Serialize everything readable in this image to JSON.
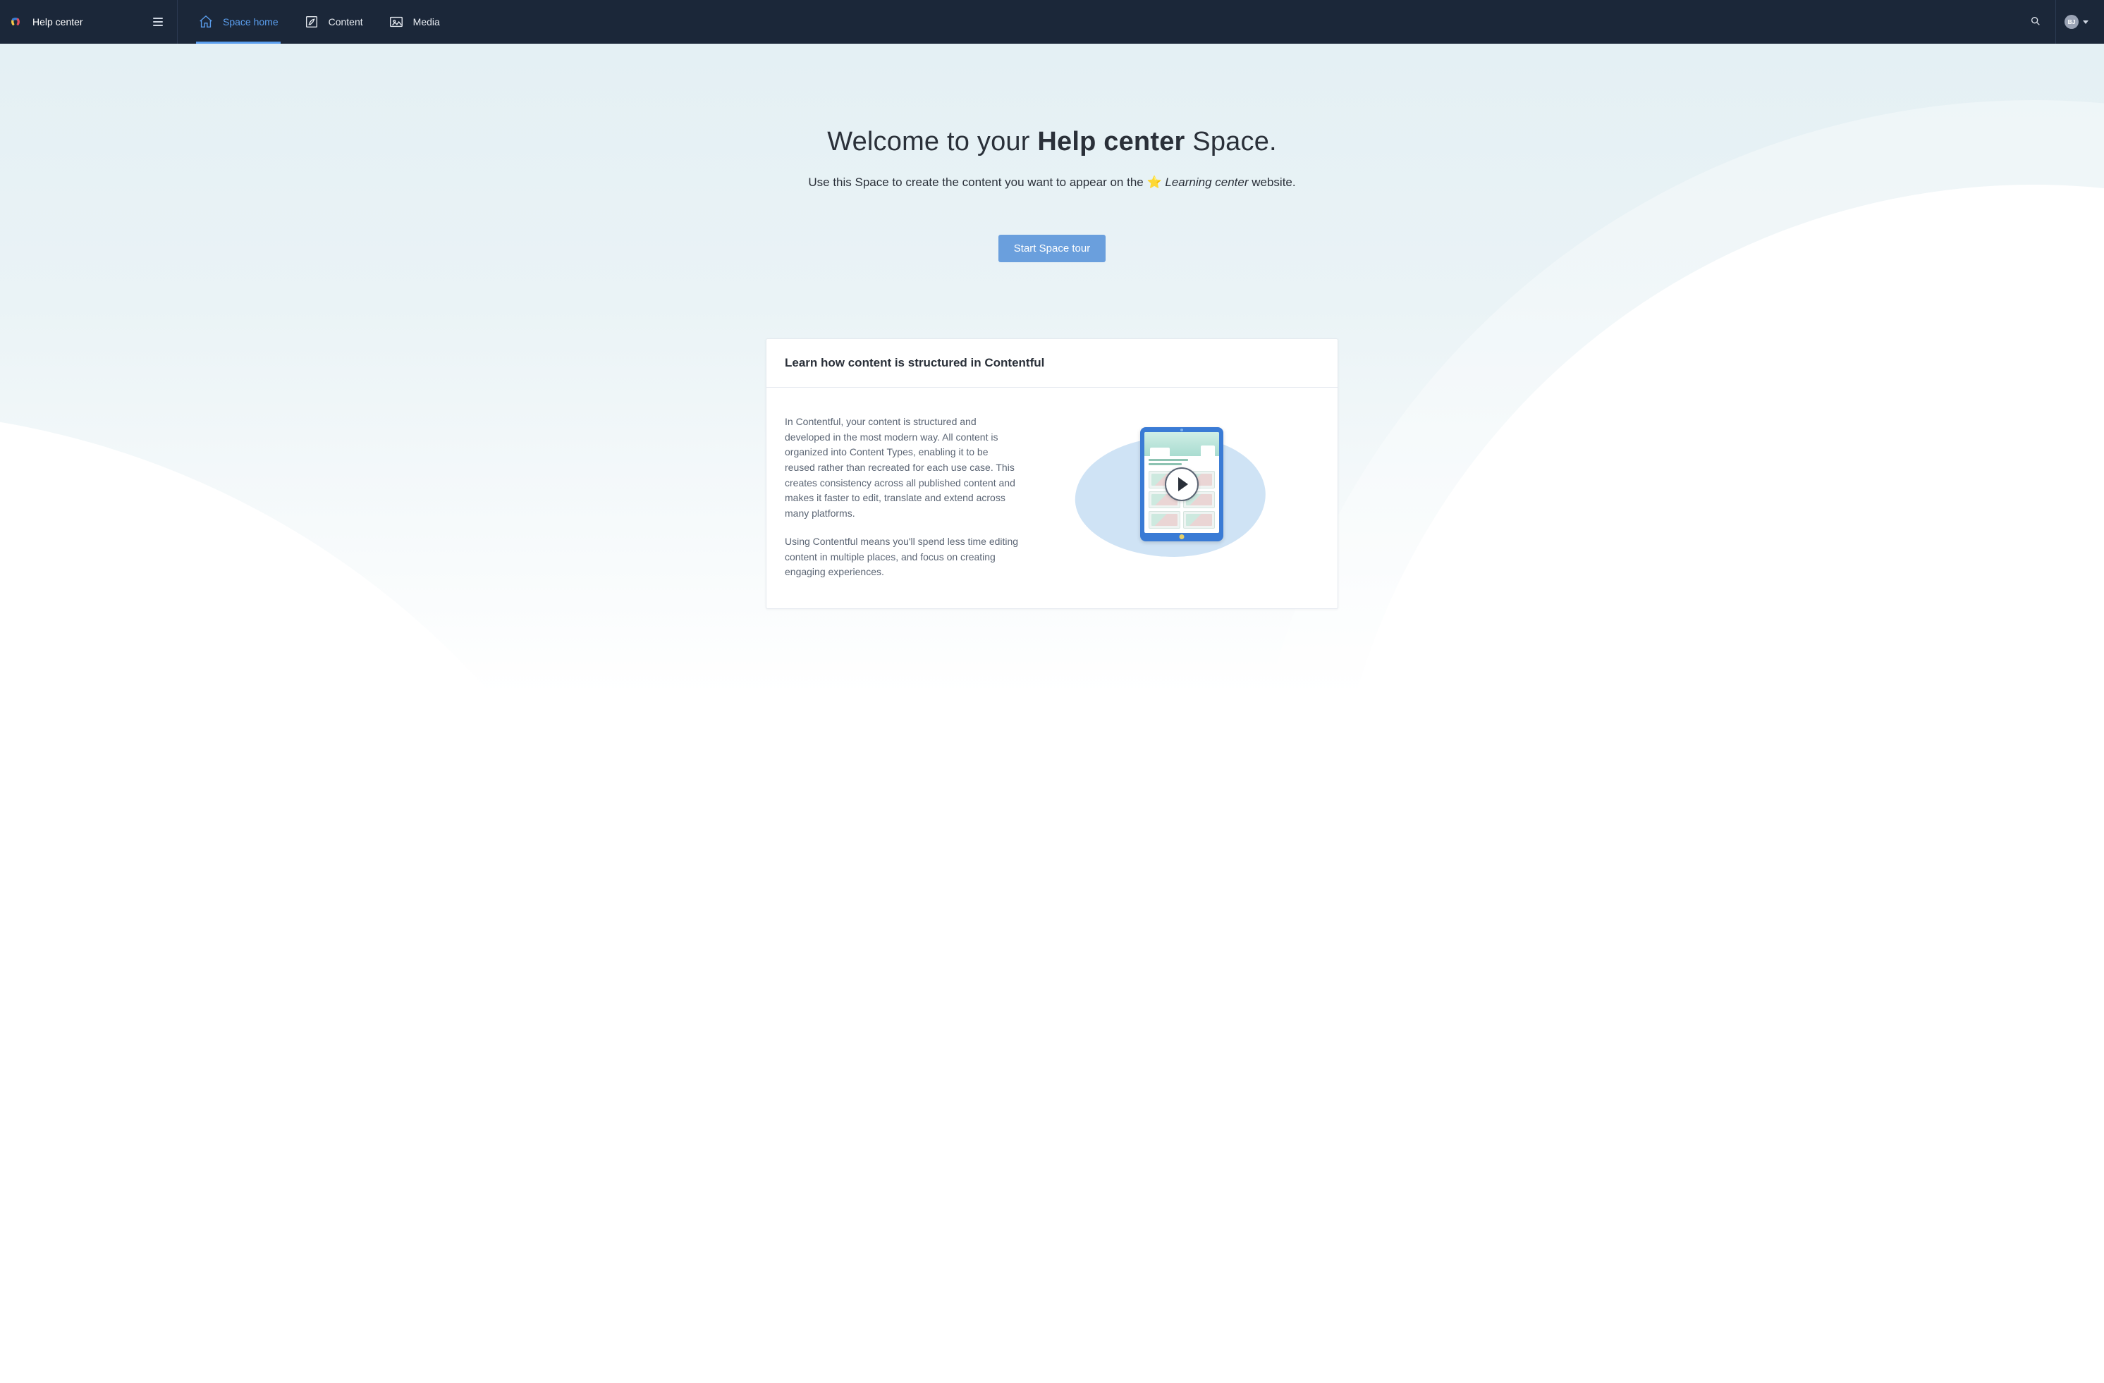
{
  "header": {
    "space_name": "Help center",
    "tabs": [
      {
        "label": "Space home",
        "active": true
      },
      {
        "label": "Content",
        "active": false
      },
      {
        "label": "Media",
        "active": false
      }
    ],
    "avatar_initials": "BJ"
  },
  "hero": {
    "title_prefix": "Welcome to your ",
    "title_strong": "Help center",
    "title_suffix": " Space.",
    "subtitle_prefix": "Use this Space to create the content you want to appear on the ",
    "subtitle_emoji": "⭐",
    "subtitle_em": "Learning center",
    "subtitle_suffix": " website.",
    "cta_label": "Start Space tour"
  },
  "card": {
    "heading": "Learn how content is structured in Contentful",
    "paragraph1": "In Contentful, your content is structured and developed in the most modern way. All content is organized into Content Types, enabling it to be reused rather than recreated for each use case. This creates consistency across all published content and makes it faster to edit, translate and extend across many platforms.",
    "paragraph2": "Using Contentful means you'll spend less time editing content in multiple places, and focus on creating engaging experiences."
  }
}
